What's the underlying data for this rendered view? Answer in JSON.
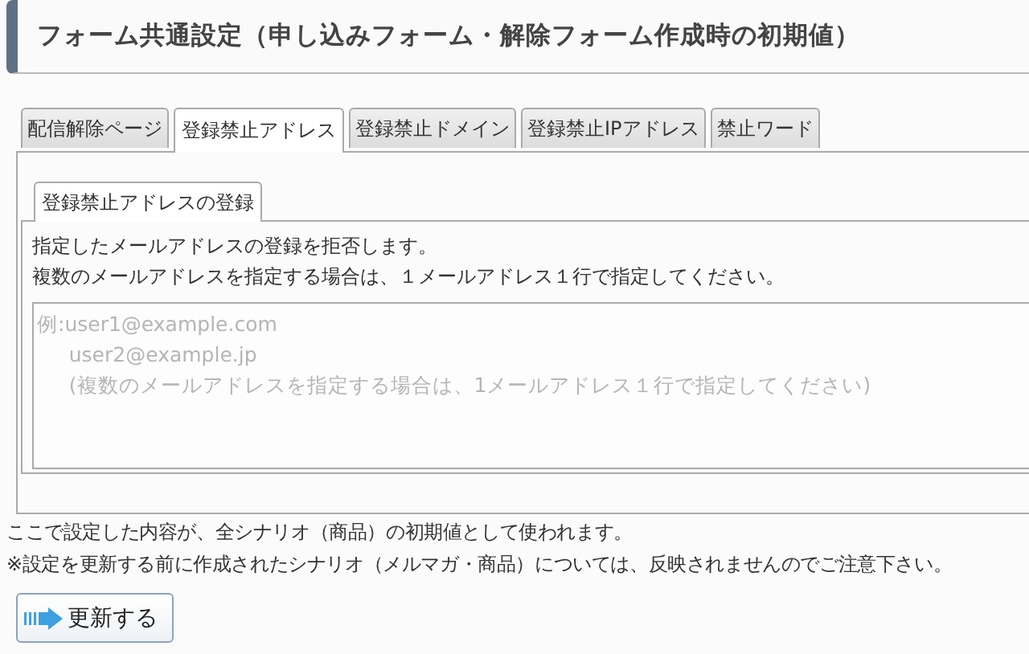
{
  "page_title": "フォーム共通設定（申し込みフォーム・解除フォーム作成時の初期値）",
  "tabs": [
    {
      "label": "配信解除ページ",
      "selected": false
    },
    {
      "label": "登録禁止アドレス",
      "selected": true
    },
    {
      "label": "登録禁止ドメイン",
      "selected": false
    },
    {
      "label": "登録禁止IPアドレス",
      "selected": false
    },
    {
      "label": "禁止ワード",
      "selected": false
    }
  ],
  "sub_tabs": [
    {
      "label": "登録禁止アドレスの登録",
      "selected": true
    }
  ],
  "description": [
    "指定したメールアドレスの登録を拒否します。",
    "複数のメールアドレスを指定する場合は、１メールアドレス１行で指定してください。"
  ],
  "address_field": {
    "placeholder": "例:user1@example.com\n     user2@example.jp\n     (複数のメールアドレスを指定する場合は、1メールアドレス１行で指定してください)"
  },
  "notes": [
    "ここで設定した内容が、全シナリオ（商品）の初期値として使われます。",
    "※設定を更新する前に作成されたシナリオ（メルマガ・商品）については、反映されませんのでご注意下さい。"
  ],
  "update_button": {
    "label": "更新する"
  }
}
